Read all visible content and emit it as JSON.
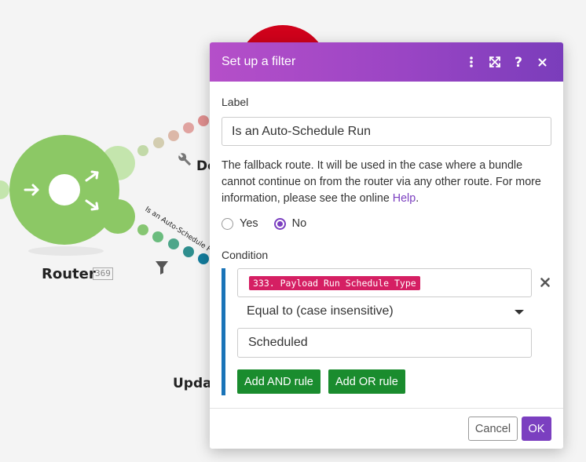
{
  "canvas": {
    "router_label": "Router",
    "router_count": "369",
    "module_label_top": "De",
    "module_label_bottom": "Updat",
    "route_label": "Is an Auto-Schedule F"
  },
  "dialog": {
    "title": "Set up a filter",
    "header_icons": [
      "more-vertical-icon",
      "expand-icon",
      "help-icon",
      "close-icon"
    ],
    "label_heading": "Label",
    "label_value": "Is an Auto-Schedule Run",
    "fallback_text": "The fallback route. It will be used in the case where a bundle cannot continue on from the router via any other route. For more information, please see the online ",
    "fallback_link": "Help",
    "fallback_end": ".",
    "fallback_options": [
      "Yes",
      "No"
    ],
    "fallback_selected": "No",
    "condition_heading": "Condition",
    "condition": {
      "operand1_pill": "333. Payload Run Schedule Type",
      "operator": "Equal to (case insensitive)",
      "operand2": "Scheduled"
    },
    "add_and_label": "Add AND rule",
    "add_or_label": "Add OR rule",
    "cancel_label": "Cancel",
    "ok_label": "OK"
  },
  "colors": {
    "header_gradient_start": "#b54fc9",
    "header_gradient_end": "#7a3dbb",
    "accent_purple": "#7b3fc0",
    "pill_red": "#d51f63",
    "button_green": "#1a8c2e",
    "condition_bar_blue": "#1a74b8",
    "router_green": "#8cc865"
  }
}
